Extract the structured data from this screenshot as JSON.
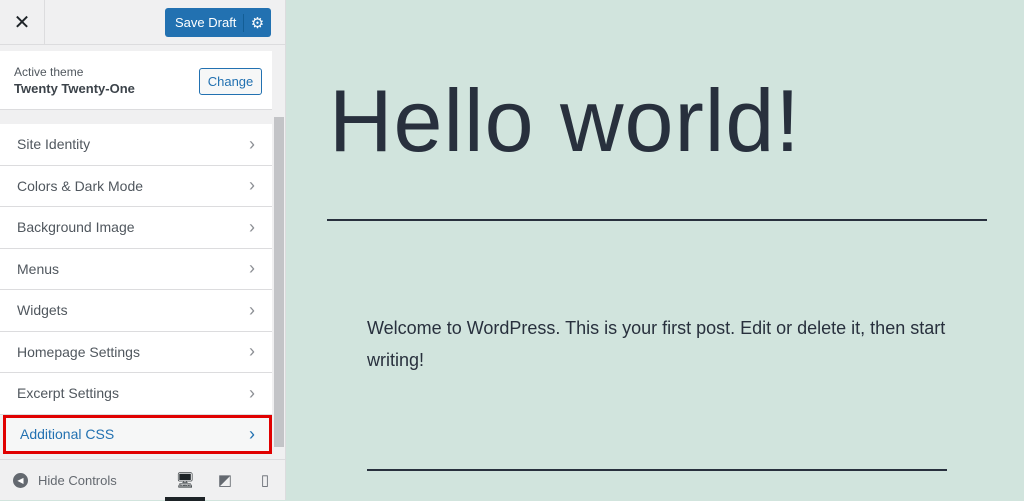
{
  "header": {
    "close_icon": "close-icon",
    "save_label": "Save Draft",
    "gear_icon": "gear-icon"
  },
  "theme": {
    "label": "Active theme",
    "name": "Twenty Twenty-One",
    "change_label": "Change"
  },
  "menu": [
    {
      "label": "Site Identity"
    },
    {
      "label": "Colors & Dark Mode"
    },
    {
      "label": "Background Image"
    },
    {
      "label": "Menus"
    },
    {
      "label": "Widgets"
    },
    {
      "label": "Homepage Settings"
    },
    {
      "label": "Excerpt Settings"
    },
    {
      "label": "Additional CSS"
    }
  ],
  "footer": {
    "hide_label": "Hide Controls"
  },
  "preview": {
    "title": "Hello world!",
    "body": "Welcome to WordPress. This is your first post. Edit or delete it, then start writing!"
  },
  "colors": {
    "accent": "#2271b1",
    "highlight": "#e00000",
    "preview_bg": "#d1e4dd"
  }
}
